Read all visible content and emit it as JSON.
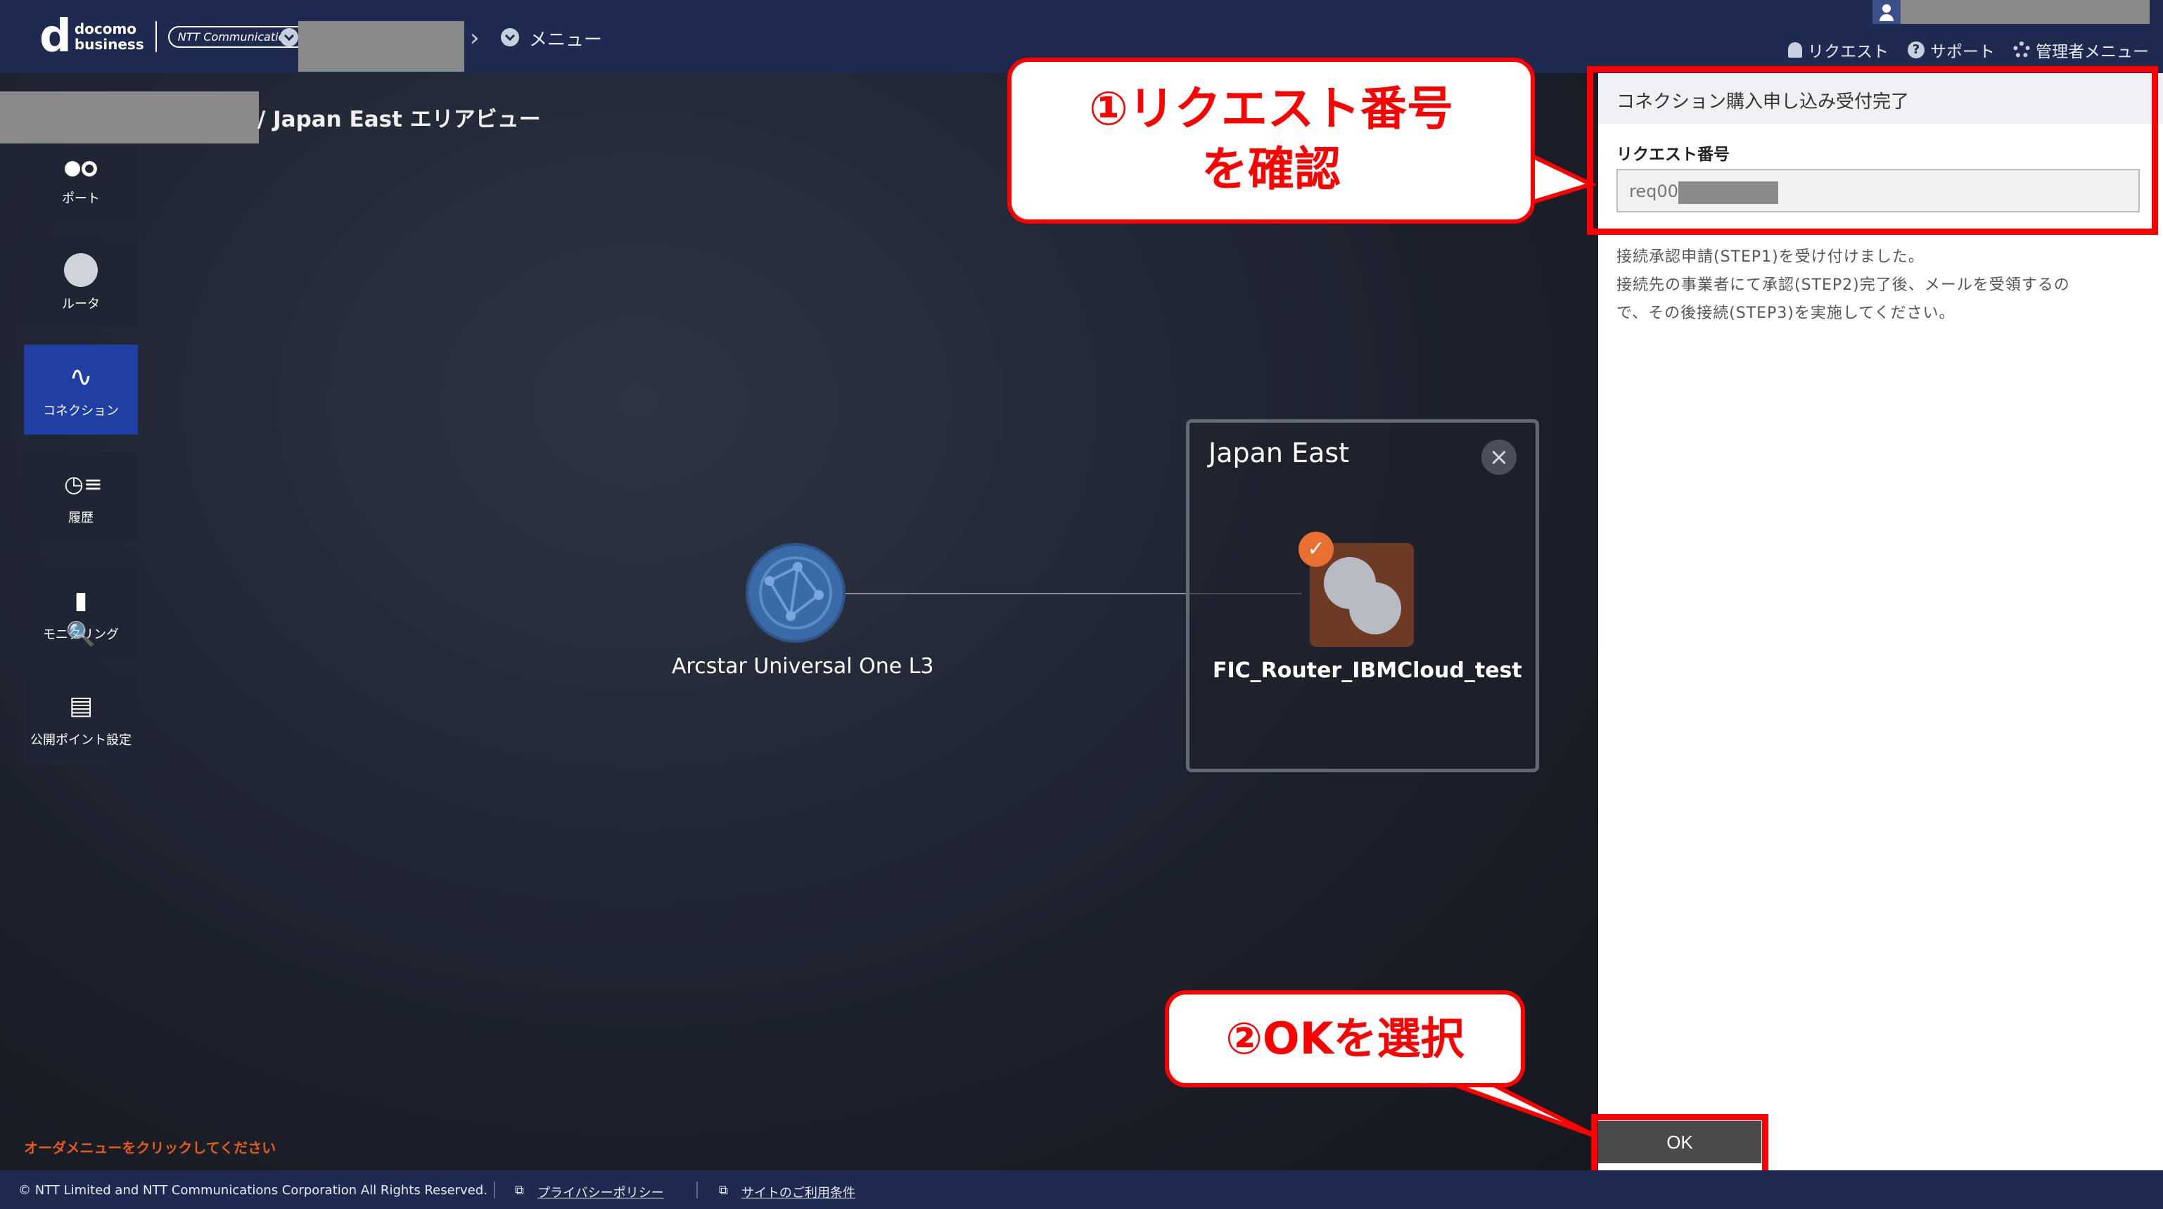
{
  "header": {
    "logo_docomo": "docomo",
    "logo_business": "business",
    "logo_ntt": "NTT Communications",
    "breadcrumb_menu": "メニュー",
    "links": {
      "request": "リクエスト",
      "support": "サポート",
      "admin_menu": "管理者メニュー"
    }
  },
  "page": {
    "title": "/ Japan East エリアビュー"
  },
  "sidebar": {
    "items": [
      {
        "label": "ポート"
      },
      {
        "label": "ルータ"
      },
      {
        "label": "コネクション"
      },
      {
        "label": "履歴"
      },
      {
        "label": "モニタリング"
      },
      {
        "label": "公開ポイント設定"
      }
    ]
  },
  "diagram": {
    "cloud_node_label": "Arcstar Universal One L3",
    "area_title": "Japan East",
    "router_name": "FIC_Router_IBMCloud_test"
  },
  "order_note": "オーダメニューをクリックしてください",
  "panel": {
    "title": "コネクション購入申し込み受付完了",
    "field_label": "リクエスト番号",
    "field_value": "req00",
    "message_lines": [
      "接続承認申請(STEP1)を受け付けました。",
      "接続先の事業者にて承認(STEP2)完了後、メールを受領するの",
      "で、その後接続(STEP3)を実施してください。"
    ],
    "ok_label": "OK"
  },
  "callouts": {
    "callout1_line1": "①リクエスト番号",
    "callout1_line2": "を確認",
    "callout2": "②OKを選択"
  },
  "footer": {
    "copyright": "© NTT Limited and NTT Communications Corporation All Rights Reserved.",
    "privacy": "プライバシーポリシー",
    "terms": "サイトのご利用条件"
  },
  "colors": {
    "header_bg": "#1e2a4f",
    "active_sidebar": "#1f3fa5",
    "callout_red": "#ff0000",
    "badge_orange": "#e86f30",
    "note_orange": "#e85a1a"
  }
}
